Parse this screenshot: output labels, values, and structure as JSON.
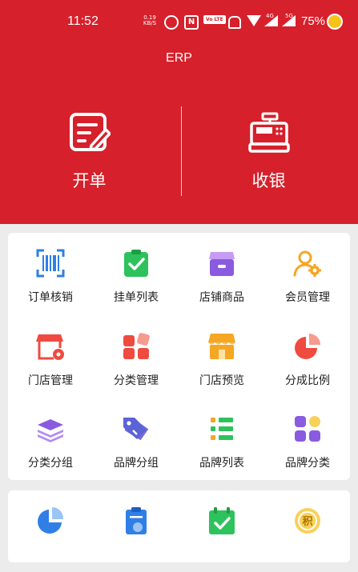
{
  "status_bar": {
    "time": "11:52",
    "net_speed": "0.19",
    "net_unit": "KB/S",
    "volte": "Vo LTE",
    "gen4": "4G",
    "gen5": "5G",
    "battery": "75%"
  },
  "app": {
    "title": "ERP"
  },
  "actions": {
    "open_order": "开单",
    "checkout": "收银"
  },
  "menu": [
    {
      "label": "订单核销",
      "icon": "scan-barcode-icon"
    },
    {
      "label": "挂单列表",
      "icon": "clipboard-check-icon"
    },
    {
      "label": "店铺商品",
      "icon": "shop-icon"
    },
    {
      "label": "会员管理",
      "icon": "member-gear-icon"
    },
    {
      "label": "门店管理",
      "icon": "store-settings-icon"
    },
    {
      "label": "分类管理",
      "icon": "category-blocks-icon"
    },
    {
      "label": "门店预览",
      "icon": "storefront-icon"
    },
    {
      "label": "分成比例",
      "icon": "pie-share-icon"
    },
    {
      "label": "分类分组",
      "icon": "layers-icon"
    },
    {
      "label": "品牌分组",
      "icon": "tags-icon"
    },
    {
      "label": "品牌列表",
      "icon": "list-icon"
    },
    {
      "label": "品牌分类",
      "icon": "grid-dots-icon"
    }
  ],
  "colors": {
    "header_red": "#d6202b",
    "blue": "#2f7fe6",
    "green": "#2ec25c",
    "purple": "#8a5be0",
    "orange": "#f5a623",
    "red": "#ef4b40"
  }
}
